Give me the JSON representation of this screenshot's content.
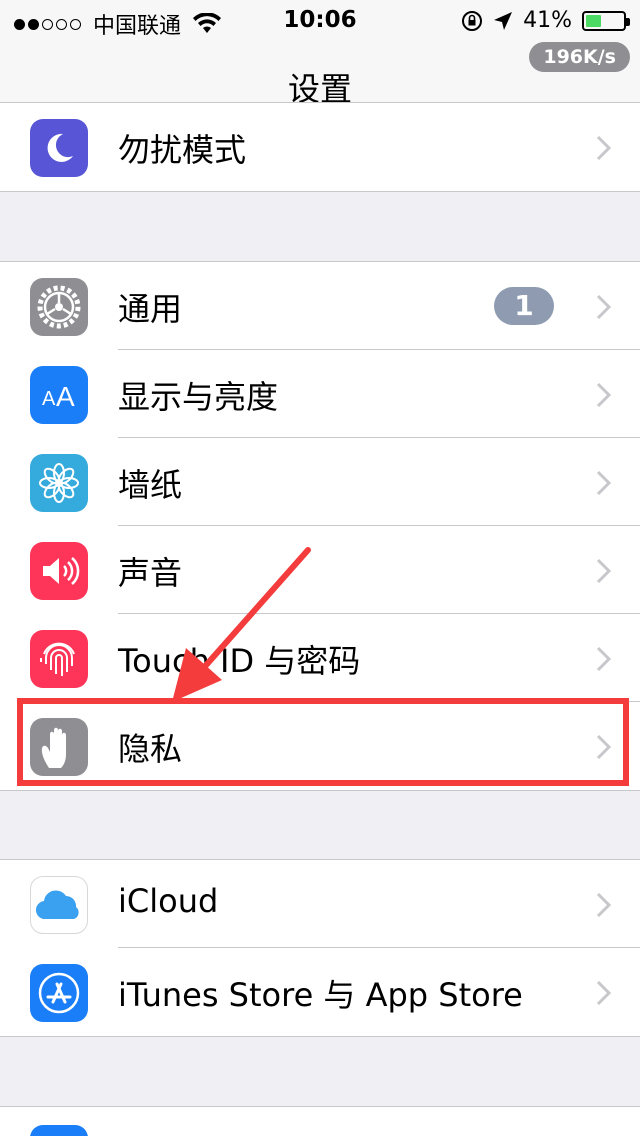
{
  "status_bar": {
    "carrier": "中国联通",
    "time": "10:06",
    "battery": "41%",
    "battery_level": 0.41,
    "network_speed": "196K/s"
  },
  "nav": {
    "title": "设置"
  },
  "group0": [
    {
      "label": "勿扰模式",
      "icon": "moon-icon",
      "color": "#5856d6"
    }
  ],
  "group1": [
    {
      "label": "通用",
      "icon": "gear-icon",
      "color": "#8e8e93",
      "badge": "1"
    },
    {
      "label": "显示与亮度",
      "icon": "display-aa-icon",
      "color": "#1a7ef8"
    },
    {
      "label": "墙纸",
      "icon": "wallpaper-flower-icon",
      "color": "#35aadc"
    },
    {
      "label": "声音",
      "icon": "speaker-icon",
      "color": "#fe3559"
    },
    {
      "label": "Touch ID 与密码",
      "icon": "fingerprint-icon",
      "color": "#fe3559"
    },
    {
      "label": "隐私",
      "icon": "hand-icon",
      "color": "#8e8e93"
    }
  ],
  "group2": [
    {
      "label": "iCloud",
      "icon": "icloud-icon",
      "color": "#ffffff"
    },
    {
      "label": "iTunes Store 与 App Store",
      "icon": "app-store-icon",
      "color": "#1a7ef8"
    }
  ],
  "annotation": {
    "highlight_color": "#f43c3c"
  }
}
